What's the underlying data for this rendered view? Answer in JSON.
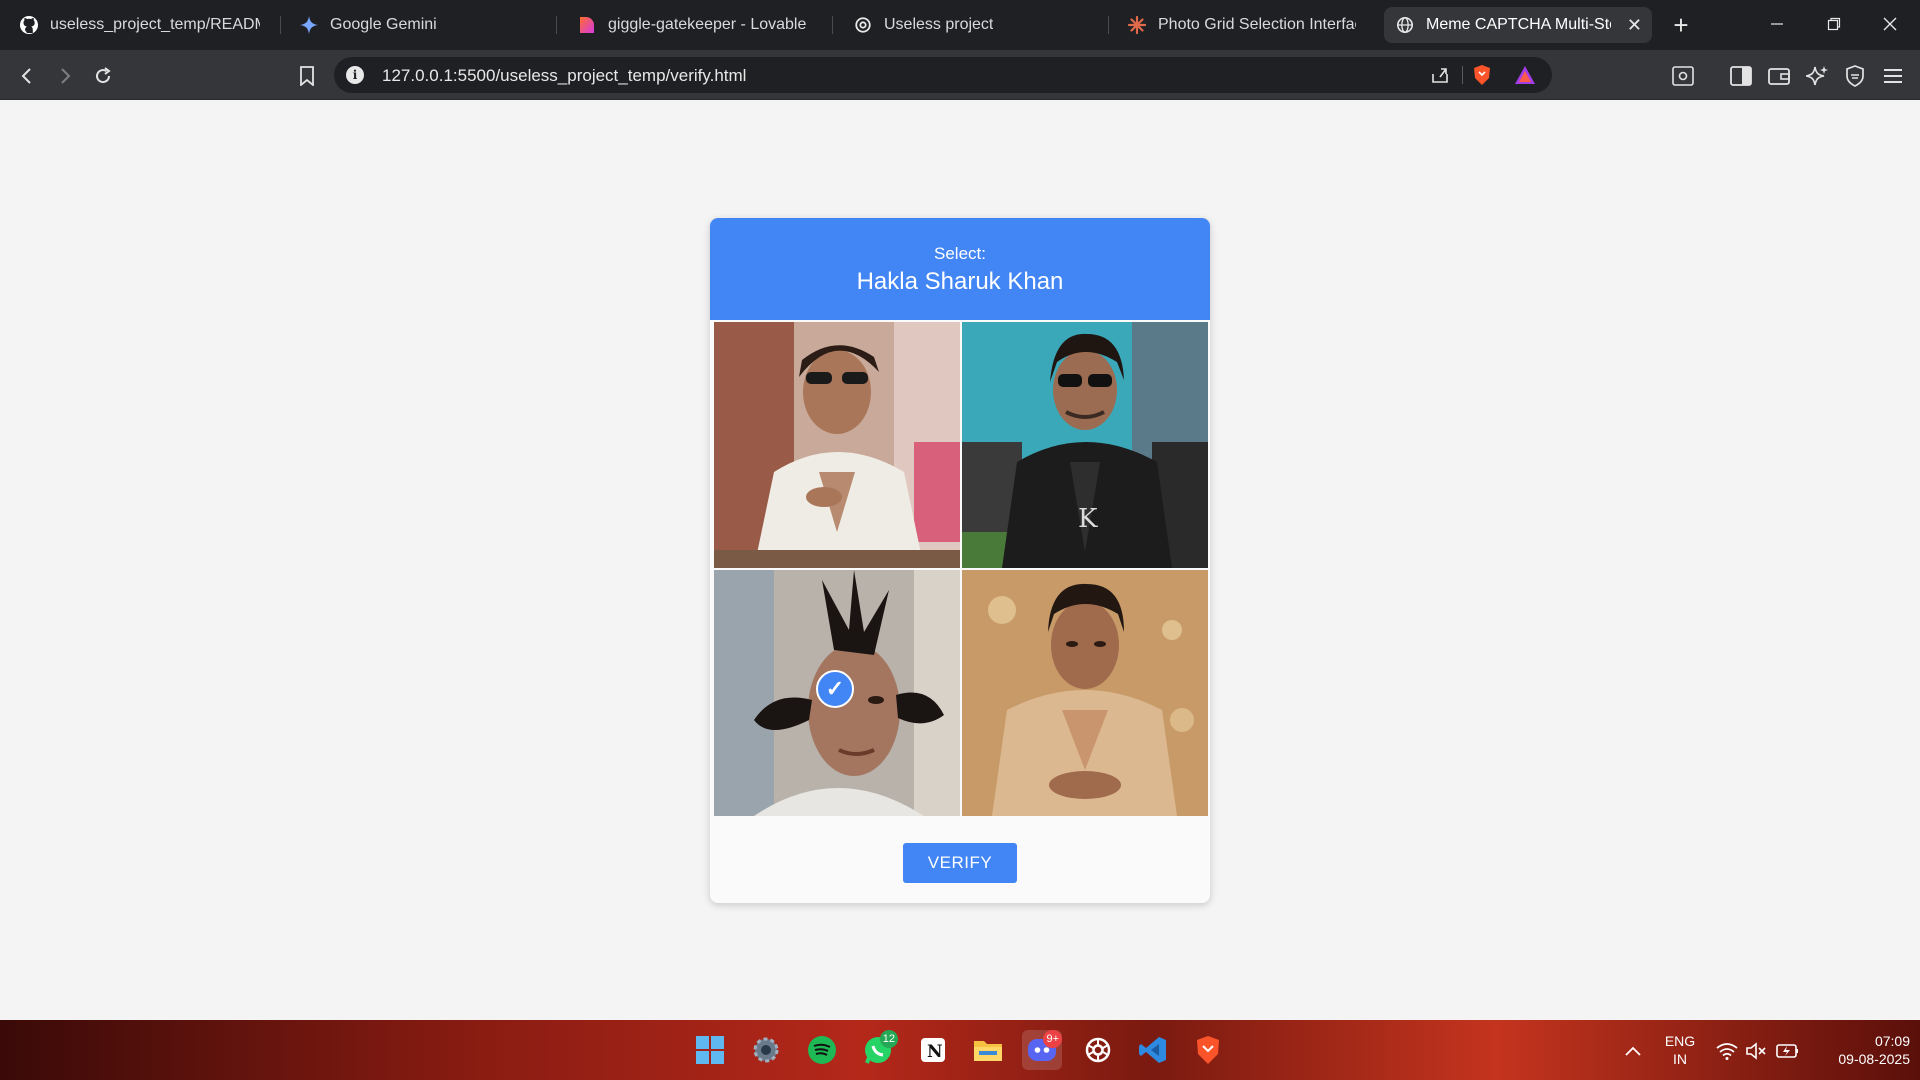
{
  "browser": {
    "tabs": [
      {
        "title": "useless_project_temp/README.m",
        "icon": "github-icon"
      },
      {
        "title": "Google Gemini",
        "icon": "gemini-icon"
      },
      {
        "title": "giggle-gatekeeper - Lovable",
        "icon": "lovable-icon"
      },
      {
        "title": "Useless project",
        "icon": "chatgpt-icon"
      },
      {
        "title": "Photo Grid Selection Interface -",
        "icon": "claude-icon"
      },
      {
        "title": "Meme CAPTCHA Multi-Step",
        "icon": "globe-icon",
        "active": true
      }
    ],
    "new_tab": "+",
    "close_tab": "✕",
    "address": "127.0.0.1:5500/useless_project_temp/verify.html"
  },
  "captcha": {
    "select_label": "Select:",
    "target_name": "Hakla Sharuk Khan",
    "tiles": [
      {
        "name": "tile-1",
        "selected": false
      },
      {
        "name": "tile-2",
        "selected": false
      },
      {
        "name": "tile-3",
        "selected": true
      },
      {
        "name": "tile-4",
        "selected": false
      }
    ],
    "check_mark": "✓",
    "verify_label": "VERIFY",
    "accent_color": "#4285f4"
  },
  "taskbar": {
    "apps": [
      "start",
      "settings",
      "spotify",
      "whatsapp",
      "notion",
      "file-explorer",
      "discord",
      "chatgpt",
      "vscode",
      "brave"
    ],
    "whatsapp_badge": "12",
    "discord_badge": "9+",
    "language": "ENG",
    "region": "IN",
    "time": "07:09",
    "date": "09-08-2025"
  }
}
